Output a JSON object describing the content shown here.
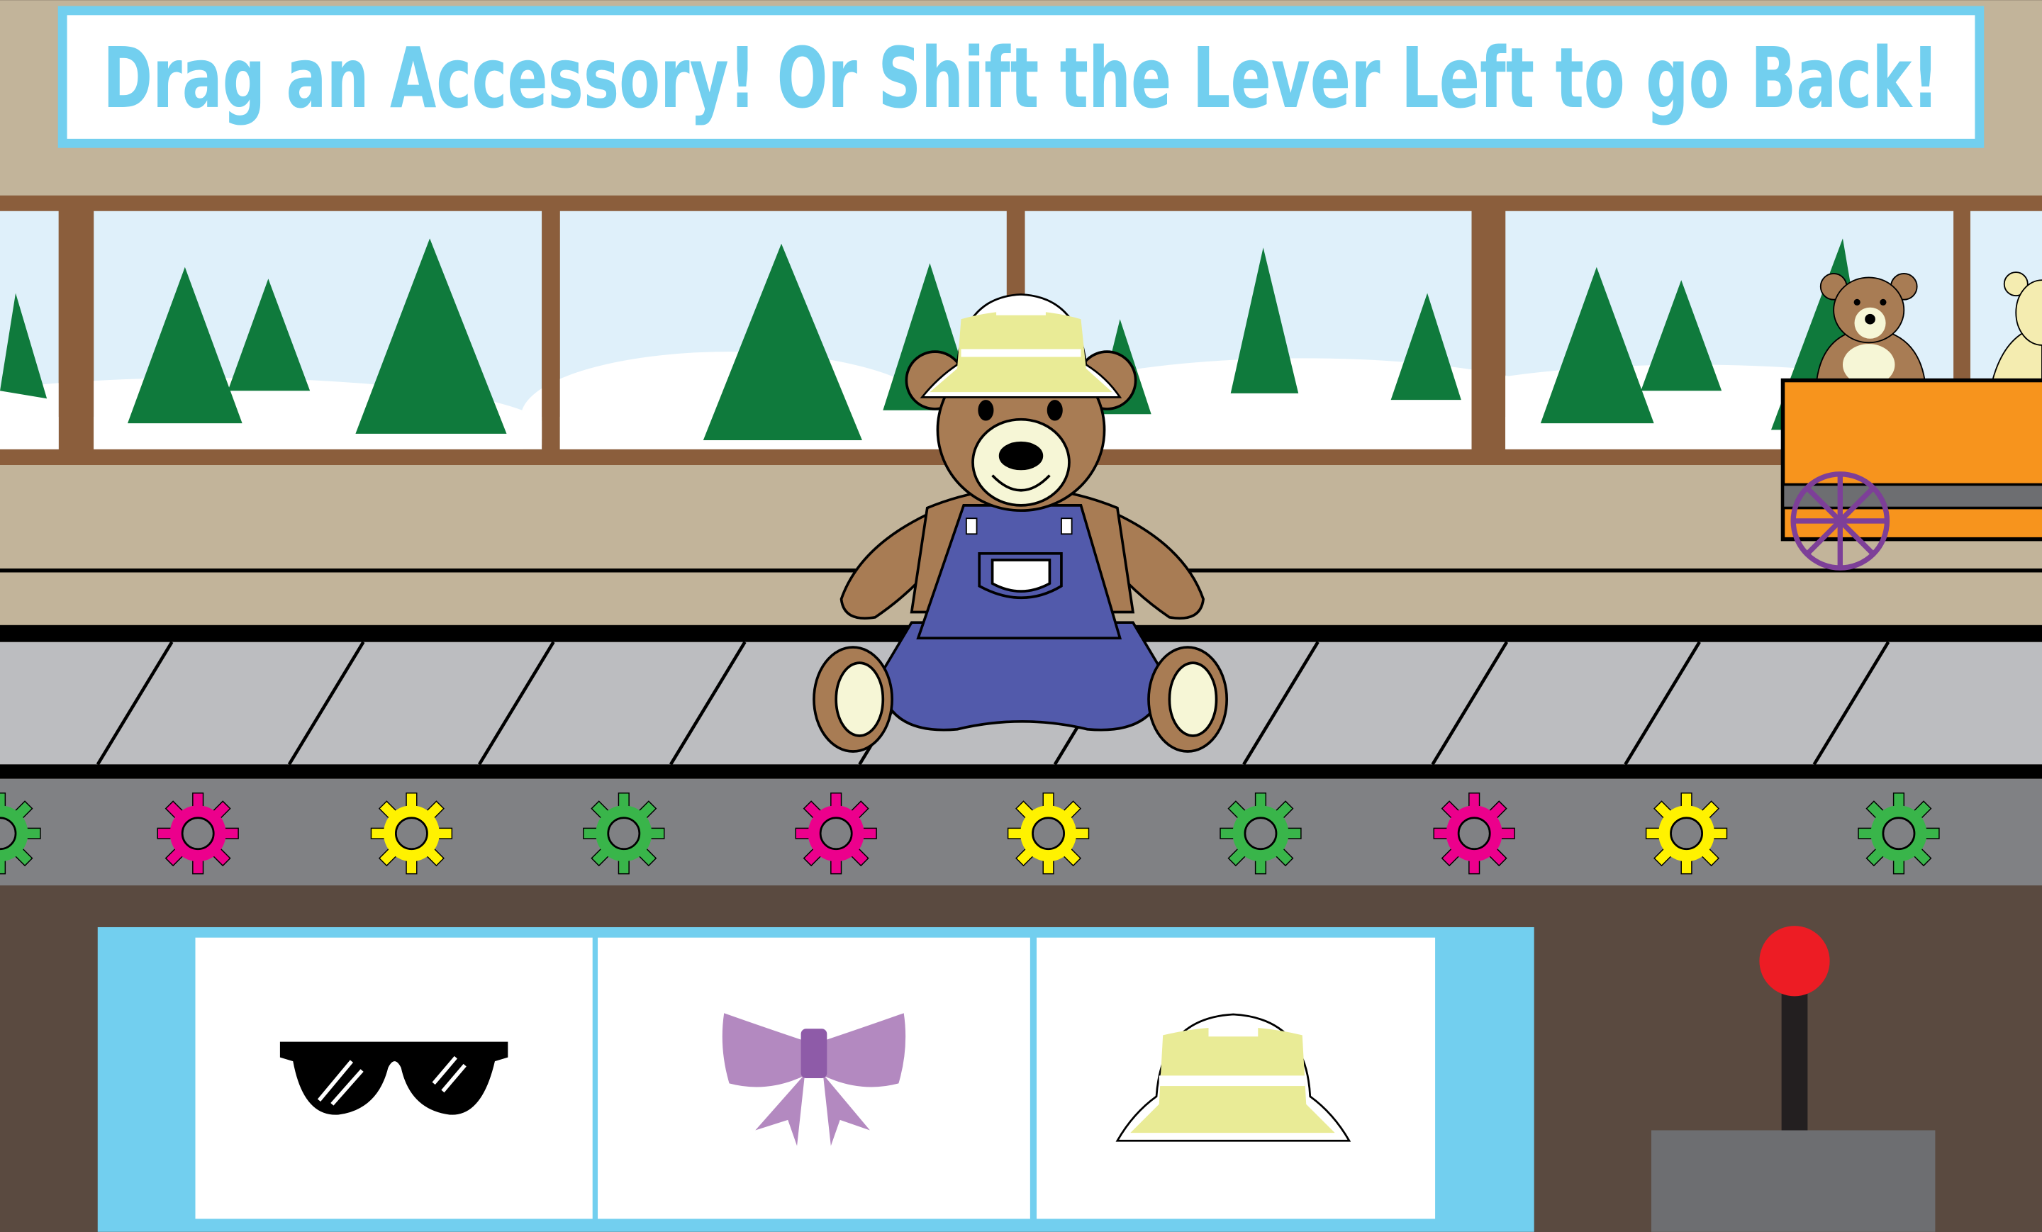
{
  "banner": {
    "instruction": "Drag an Accessory! Or Shift the Lever Left to go Back!"
  },
  "accessories": [
    {
      "name": "sunglasses",
      "icon": "sunglasses-icon"
    },
    {
      "name": "bow",
      "icon": "bow-icon"
    },
    {
      "name": "bucket hat",
      "icon": "bucket-hat-icon"
    }
  ],
  "bear": {
    "wearing": [
      "overalls",
      "bucket hat"
    ]
  },
  "colors": {
    "banner_border": "#72cfef",
    "wall": "#c2b49a",
    "window_frame": "#8b5e3c",
    "sky": "#dff0fa",
    "tree": "#0f7a3c",
    "belt": "#bcbdc0",
    "gear_strip": "#808184",
    "floor": "#5a4a40",
    "tray": "#72cfef",
    "lever_knob": "#ed1c24",
    "cart": "#f7941d"
  }
}
